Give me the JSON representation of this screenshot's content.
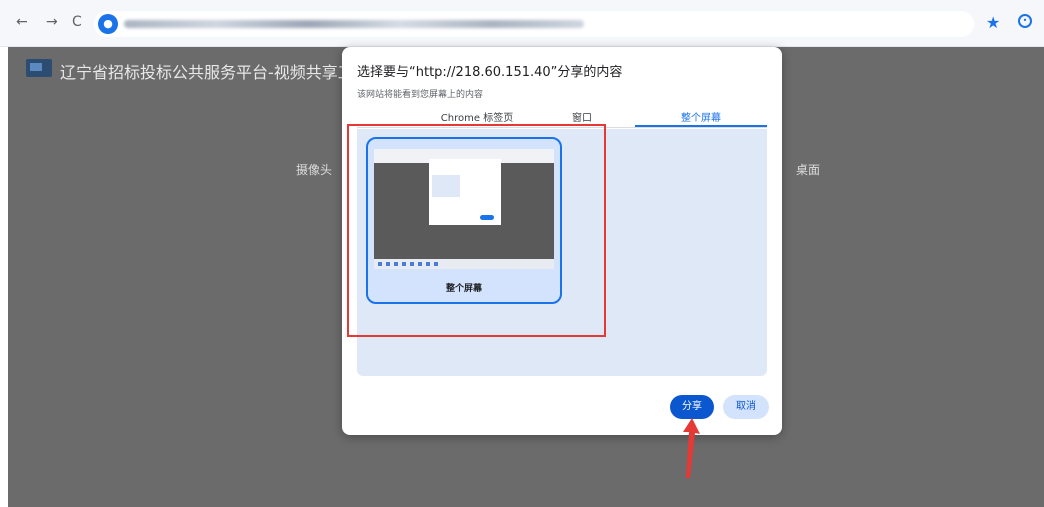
{
  "browser": {
    "back_icon": "←",
    "forward_icon": "→",
    "reload_icon": "C",
    "site_icon": "mic-icon",
    "star_icon": "★",
    "profile_icon": "profile-icon"
  },
  "page": {
    "title": "辽宁省招标投标公共服务平台-视频共享工具",
    "camera_label": "摄像头",
    "desktop_label": "桌面"
  },
  "dialog": {
    "title": "选择要与“http://218.60.151.40”分享的内容",
    "subtitle": "该网站将能看到您屏幕上的内容",
    "tabs": [
      {
        "label": "Chrome 标签页",
        "active": false
      },
      {
        "label": "窗口",
        "active": false
      },
      {
        "label": "整个屏幕",
        "active": true
      }
    ],
    "screen_label": "整个屏幕",
    "share_label": "分享",
    "cancel_label": "取消"
  },
  "colors": {
    "accent": "#1a73e8",
    "primary_button": "#0b57d0",
    "annotation": "#e53935",
    "overlay": "#6b6b6b"
  }
}
